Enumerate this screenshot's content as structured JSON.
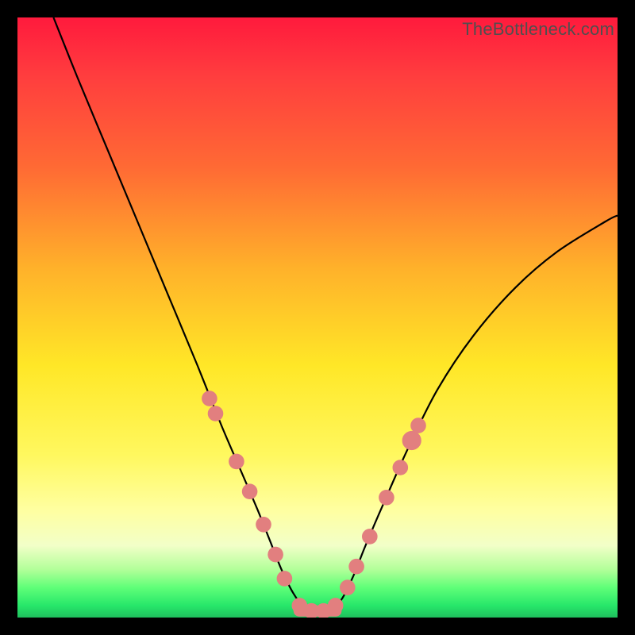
{
  "watermark": "TheBottleneck.com",
  "chart_data": {
    "type": "line",
    "title": "",
    "xlabel": "",
    "ylabel": "",
    "xlim": [
      0,
      100
    ],
    "ylim": [
      0,
      100
    ],
    "series": [
      {
        "name": "curve",
        "x": [
          6,
          10,
          15,
          20,
          25,
          30,
          34,
          37,
          40,
          42,
          44,
          46,
          48,
          50,
          52,
          54,
          56,
          58,
          61,
          65,
          70,
          76,
          83,
          90,
          98,
          100
        ],
        "y": [
          100,
          90,
          78,
          66,
          54,
          42,
          32,
          25,
          18,
          13,
          8,
          4,
          1.5,
          1,
          1.2,
          3,
          7,
          12,
          19,
          28,
          38,
          47,
          55,
          61,
          66,
          67
        ]
      }
    ],
    "markers": {
      "name": "pink-markers",
      "color": "#e27f7f",
      "points": [
        {
          "x": 32.0,
          "y": 36.5,
          "r": 1.3
        },
        {
          "x": 33.0,
          "y": 34.0,
          "r": 1.3
        },
        {
          "x": 36.5,
          "y": 26.0,
          "r": 1.3
        },
        {
          "x": 38.7,
          "y": 21.0,
          "r": 1.3
        },
        {
          "x": 41.0,
          "y": 15.5,
          "r": 1.3
        },
        {
          "x": 43.0,
          "y": 10.5,
          "r": 1.3
        },
        {
          "x": 44.5,
          "y": 6.5,
          "r": 1.3
        },
        {
          "x": 47.0,
          "y": 2.0,
          "r": 1.3
        },
        {
          "x": 49.0,
          "y": 1.1,
          "r": 1.3
        },
        {
          "x": 51.0,
          "y": 1.1,
          "r": 1.3
        },
        {
          "x": 53.0,
          "y": 2.0,
          "r": 1.3
        },
        {
          "x": 55.0,
          "y": 5.0,
          "r": 1.3
        },
        {
          "x": 56.5,
          "y": 8.5,
          "r": 1.3
        },
        {
          "x": 58.7,
          "y": 13.5,
          "r": 1.3
        },
        {
          "x": 61.5,
          "y": 20.0,
          "r": 1.3
        },
        {
          "x": 63.8,
          "y": 25.0,
          "r": 1.3
        },
        {
          "x": 65.7,
          "y": 29.5,
          "r": 1.6
        },
        {
          "x": 66.8,
          "y": 32.0,
          "r": 1.3
        }
      ]
    },
    "flat_segment": {
      "x0": 46.0,
      "x1": 54.0,
      "y": 1.1
    }
  }
}
